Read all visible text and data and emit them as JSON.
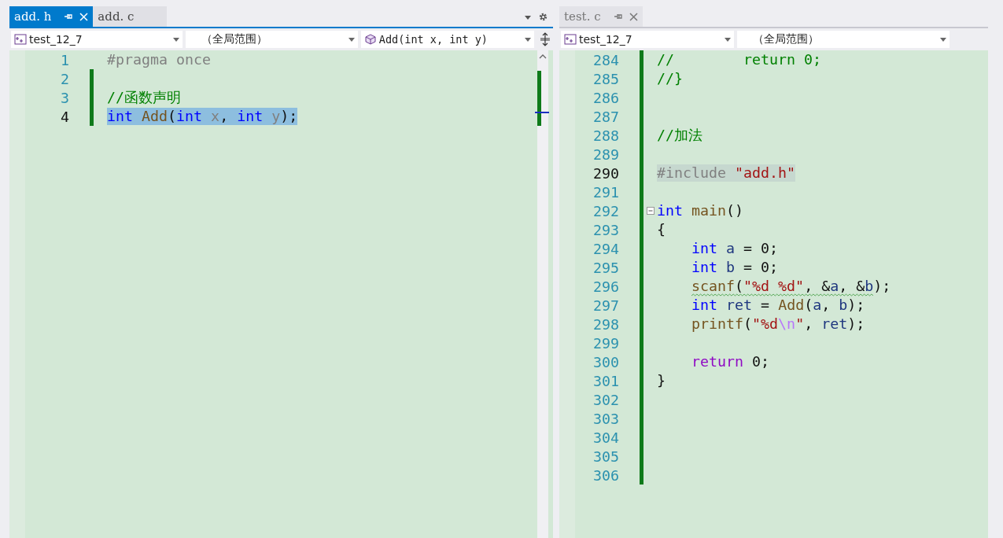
{
  "editors": [
    {
      "tabs": [
        {
          "label": "add. h",
          "selected": true,
          "pinnable": true,
          "closable": true
        },
        {
          "label": "add. c",
          "selected": false,
          "pinnable": false,
          "closable": false
        }
      ],
      "tab_bar_tools": true,
      "nav": [
        {
          "kind": "project",
          "text": "test_12_7"
        },
        {
          "kind": "scope",
          "text": "（全局范围）"
        },
        {
          "kind": "member",
          "text": "Add(int x,  int y)"
        }
      ],
      "split_button": true,
      "scrollbar": true,
      "lines": [
        {
          "number": "1",
          "current": false,
          "changed": false,
          "selected": false,
          "reference_highlight": false,
          "warning": false,
          "fold": false,
          "tokens": [
            {
              "t": "#pragma once",
              "kind": "pre"
            }
          ]
        },
        {
          "number": "2",
          "current": false,
          "changed": true,
          "fold": false
        },
        {
          "number": "3",
          "current": false,
          "changed": true,
          "selected": false,
          "reference_highlight": false,
          "warning": false,
          "fold": false,
          "tokens": [
            {
              "t": "//函数声明",
              "kind": "comment"
            }
          ]
        },
        {
          "number": "4",
          "current": true,
          "changed": true,
          "selected": true,
          "reference_highlight": false,
          "warning": false,
          "fold": false,
          "tokens": [
            {
              "t": "int ",
              "kind": "kw"
            },
            {
              "t": "Add",
              "kind": "fn"
            },
            {
              "t": "(",
              "kind": "plain"
            },
            {
              "t": "int ",
              "kind": "kw"
            },
            {
              "t": "x",
              "kind": "param"
            },
            {
              "t": ", ",
              "kind": "plain"
            },
            {
              "t": "int ",
              "kind": "kw"
            },
            {
              "t": "y",
              "kind": "param"
            },
            {
              "t": ");",
              "kind": "plain"
            }
          ]
        }
      ]
    },
    {
      "tabs": [
        {
          "label": "test. c",
          "selected": false,
          "pinnable": true,
          "closable": true
        }
      ],
      "tab_bar_tools": false,
      "nav": [
        {
          "kind": "project",
          "text": "test_12_7"
        },
        {
          "kind": "scope",
          "text": "（全局范围）"
        }
      ],
      "split_button": false,
      "scrollbar": false,
      "lines": [
        {
          "number": "284",
          "current": false,
          "changed": true,
          "selected": false,
          "reference_highlight": false,
          "warning": false,
          "fold": false,
          "tokens": [
            {
              "t": "//        return 0;",
              "kind": "comment"
            }
          ]
        },
        {
          "number": "285",
          "current": false,
          "changed": true,
          "selected": false,
          "reference_highlight": false,
          "warning": false,
          "fold": false,
          "tokens": [
            {
              "t": "//}",
              "kind": "comment"
            }
          ]
        },
        {
          "number": "286",
          "current": false,
          "changed": true,
          "fold": false
        },
        {
          "number": "287",
          "current": false,
          "changed": true,
          "fold": false
        },
        {
          "number": "288",
          "current": false,
          "changed": true,
          "selected": false,
          "reference_highlight": false,
          "warning": false,
          "fold": false,
          "tokens": [
            {
              "t": "//加法",
              "kind": "comment"
            }
          ]
        },
        {
          "number": "289",
          "current": false,
          "changed": true,
          "fold": false
        },
        {
          "number": "290",
          "current": true,
          "changed": true,
          "selected": false,
          "reference_highlight": true,
          "warning": false,
          "fold": false,
          "tokens": [
            {
              "t": "#include ",
              "kind": "pre"
            },
            {
              "t": "\"add.h\"",
              "kind": "str"
            }
          ]
        },
        {
          "number": "291",
          "current": false,
          "changed": true,
          "fold": false
        },
        {
          "number": "292",
          "current": false,
          "changed": true,
          "selected": false,
          "reference_highlight": false,
          "warning": false,
          "fold": true,
          "tokens": [
            {
              "t": "int ",
              "kind": "kw"
            },
            {
              "t": "main",
              "kind": "fn"
            },
            {
              "t": "()",
              "kind": "plain"
            }
          ]
        },
        {
          "number": "293",
          "current": false,
          "changed": true,
          "selected": false,
          "reference_highlight": false,
          "warning": false,
          "fold": false,
          "tokens": [
            {
              "t": "{",
              "kind": "plain"
            }
          ]
        },
        {
          "number": "294",
          "current": false,
          "changed": true,
          "selected": false,
          "reference_highlight": false,
          "warning": false,
          "fold": false,
          "tokens": [
            {
              "t": "    int ",
              "kind": "kw"
            },
            {
              "t": "a",
              "kind": "var"
            },
            {
              "t": " = 0;",
              "kind": "plain"
            }
          ]
        },
        {
          "number": "295",
          "current": false,
          "changed": true,
          "selected": false,
          "reference_highlight": false,
          "warning": false,
          "fold": false,
          "tokens": [
            {
              "t": "    int ",
              "kind": "kw"
            },
            {
              "t": "b",
              "kind": "var"
            },
            {
              "t": " = 0;",
              "kind": "plain"
            }
          ]
        },
        {
          "number": "296",
          "current": false,
          "changed": true,
          "selected": false,
          "reference_highlight": false,
          "warning": true,
          "fold": false,
          "tokens": [
            {
              "t": "    scanf",
              "kind": "fn"
            },
            {
              "t": "(",
              "kind": "plain"
            },
            {
              "t": "\"%d %d\"",
              "kind": "str"
            },
            {
              "t": ", &",
              "kind": "plain"
            },
            {
              "t": "a",
              "kind": "var"
            },
            {
              "t": ", &",
              "kind": "plain"
            },
            {
              "t": "b",
              "kind": "var"
            },
            {
              "t": ");",
              "kind": "plain"
            }
          ]
        },
        {
          "number": "297",
          "current": false,
          "changed": true,
          "selected": false,
          "reference_highlight": false,
          "warning": false,
          "fold": false,
          "tokens": [
            {
              "t": "    int ",
              "kind": "kw"
            },
            {
              "t": "ret",
              "kind": "var"
            },
            {
              "t": " = ",
              "kind": "plain"
            },
            {
              "t": "Add",
              "kind": "fn"
            },
            {
              "t": "(",
              "kind": "plain"
            },
            {
              "t": "a",
              "kind": "var"
            },
            {
              "t": ", ",
              "kind": "plain"
            },
            {
              "t": "b",
              "kind": "var"
            },
            {
              "t": ");",
              "kind": "plain"
            }
          ]
        },
        {
          "number": "298",
          "current": false,
          "changed": true,
          "selected": false,
          "reference_highlight": false,
          "warning": false,
          "fold": false,
          "tokens": [
            {
              "t": "    printf",
              "kind": "fn"
            },
            {
              "t": "(",
              "kind": "plain"
            },
            {
              "t": "\"%d",
              "kind": "str"
            },
            {
              "t": "\\n",
              "kind": "esc"
            },
            {
              "t": "\"",
              "kind": "str"
            },
            {
              "t": ", ",
              "kind": "plain"
            },
            {
              "t": "ret",
              "kind": "var"
            },
            {
              "t": ");",
              "kind": "plain"
            }
          ]
        },
        {
          "number": "299",
          "current": false,
          "changed": true,
          "fold": false
        },
        {
          "number": "300",
          "current": false,
          "changed": true,
          "selected": false,
          "reference_highlight": false,
          "warning": false,
          "fold": false,
          "tokens": [
            {
              "t": "    return",
              "kind": "ctl"
            },
            {
              "t": " 0;",
              "kind": "plain"
            }
          ]
        },
        {
          "number": "301",
          "current": false,
          "changed": true,
          "selected": false,
          "reference_highlight": false,
          "warning": false,
          "fold": false,
          "tokens": [
            {
              "t": "}",
              "kind": "plain"
            }
          ]
        },
        {
          "number": "302",
          "current": false,
          "changed": true,
          "fold": false
        },
        {
          "number": "303",
          "current": false,
          "changed": true,
          "fold": false
        },
        {
          "number": "304",
          "current": false,
          "changed": true,
          "fold": false
        },
        {
          "number": "305",
          "current": false,
          "changed": true,
          "fold": false
        },
        {
          "number": "306",
          "current": false,
          "changed": true,
          "fold": false
        }
      ]
    }
  ]
}
